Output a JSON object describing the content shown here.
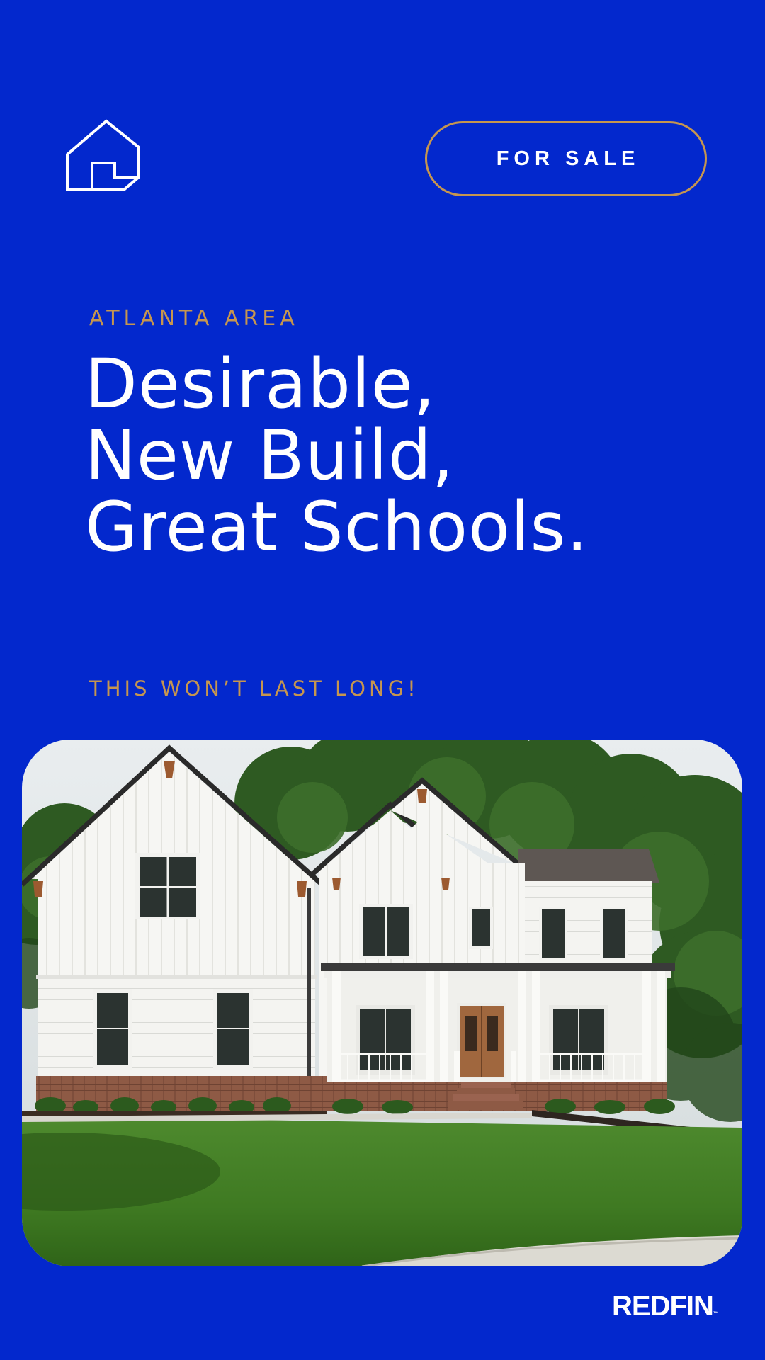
{
  "colors": {
    "background": "#0328CD",
    "accent_gold": "#C6964F",
    "text": "#FFFFFF"
  },
  "header": {
    "icon": "house-outline-icon",
    "button_label": "FOR SALE"
  },
  "listing": {
    "location": "ATLANTA AREA",
    "headline_lines": [
      "Desirable,",
      "New Build,",
      "Great Schools."
    ],
    "tagline": "THIS WON’T LAST LONG!"
  },
  "photo": {
    "subject": "white farmhouse-style two-story new build home with front porch and green lawn"
  },
  "footer": {
    "logo_text": "REDFIN",
    "logo_mark": "™"
  }
}
